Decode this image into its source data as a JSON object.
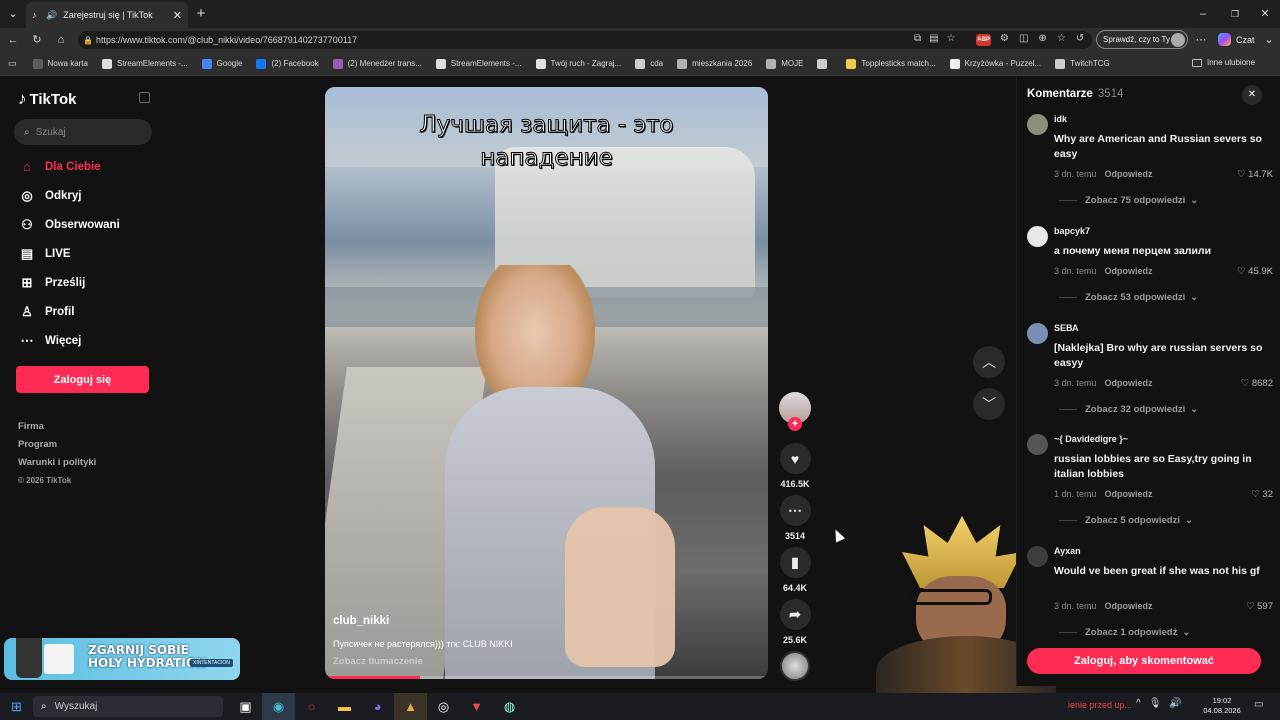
{
  "browser": {
    "tab_title": "Zarejestruj się | TikTok",
    "url": "https://www.tiktok.com/@club_nikki/video/7668791402737700117",
    "profile_button": "Sprawdź, czy to Ty",
    "chat_label": "Czat",
    "other_favorites": "Inne ulubione",
    "bookmarks": [
      {
        "label": "Nowa karta",
        "color": "#5b5b5b"
      },
      {
        "label": "StreamElements -...",
        "color": "#dddddd"
      },
      {
        "label": "Google",
        "color": "#4285f4"
      },
      {
        "label": "(2) Facebook",
        "color": "#1877f2"
      },
      {
        "label": "(2) Menedżer trans...",
        "color": "#9b59b6"
      },
      {
        "label": "StreamElements -...",
        "color": "#dddddd"
      },
      {
        "label": "Twój ruch - Zagraj...",
        "color": "#e0e0e0"
      },
      {
        "label": "cda",
        "color": "#cccccc"
      },
      {
        "label": "mieszkania 2026",
        "color": "#b0b0b0"
      },
      {
        "label": "MOJE",
        "color": "#b0b0b0"
      },
      {
        "label": "",
        "color": "#cccccc"
      },
      {
        "label": "Topplesticks match...",
        "color": "#f2c94c"
      },
      {
        "label": "Krzyżówka - Puzzel...",
        "color": "#f0f0f0"
      },
      {
        "label": "TwitchTCG",
        "color": "#cccccc"
      }
    ]
  },
  "sidebar": {
    "logo": "TikTok",
    "search_placeholder": "Szukaj",
    "items": [
      {
        "label": "Dla Ciebie",
        "icon": "home-icon",
        "active": true
      },
      {
        "label": "Odkryj",
        "icon": "compass-icon"
      },
      {
        "label": "Obserwowani",
        "icon": "following-icon"
      },
      {
        "label": "LIVE",
        "icon": "live-icon"
      },
      {
        "label": "Prześlij",
        "icon": "upload-icon"
      },
      {
        "label": "Profil",
        "icon": "profile-icon"
      },
      {
        "label": "Więcej",
        "icon": "more-icon"
      }
    ],
    "login_button": "Zaloguj się",
    "footer": [
      "Firma",
      "Program",
      "Warunki i polityki"
    ],
    "copyright": "© 2026 TikTok",
    "accent": "#fe2c55"
  },
  "video": {
    "overlay_text": "Лучшая защита - это нападение",
    "author": "club_nikki",
    "caption": "Пупсичек не растерялся))) тгк: CLUB NIKKI",
    "translate": "Zobacz tłumaczenie",
    "likes": "416.5K",
    "comments": "3514",
    "saves": "64.4K",
    "shares": "25.6K"
  },
  "comments_panel": {
    "title": "Komentarze",
    "count": "3514",
    "reply_label": "Odpowiedz",
    "comments": [
      {
        "user": "idk",
        "text": "Why are American and Russian severs so easy",
        "time": "3 dn. temu",
        "likes": "14.7K",
        "more": "Zobacz 75 odpowiedzi"
      },
      {
        "user": "bapcyk7",
        "text": "а почему меня перцем залили",
        "time": "3 dn. temu",
        "likes": "45.9K",
        "more": "Zobacz 53 odpowiedzi"
      },
      {
        "user": "ЅЕВА",
        "text": "[Naklejka] Bro why are russian servers so easyy",
        "time": "3 dn. temu",
        "likes": "8682",
        "more": "Zobacz 32 odpowiedzi"
      },
      {
        "user": "~{ Davidedigre }~",
        "text": "russian lobbies are so Easy,try going in italian lobbies",
        "time": "1 dn. temu",
        "likes": "32",
        "more": "Zobacz 5 odpowiedzi"
      },
      {
        "user": "Ayxan",
        "text": "Would ve been great if she was not his gf",
        "time": "3 dn. temu",
        "likes": "597",
        "more": "Zobacz 1 odpowiedź"
      }
    ],
    "login_to_comment": "Zaloguj, aby skomentować"
  },
  "ad_banner": {
    "line1": "ZGARNIJ SOBIE",
    "line2": "HOLY HYDRATION",
    "tag": "XINTENTACION"
  },
  "taskbar": {
    "search_placeholder": "Wyszukaj",
    "ticker": "ienie przed up...",
    "time": "19:02",
    "date": "04.08.2026"
  }
}
